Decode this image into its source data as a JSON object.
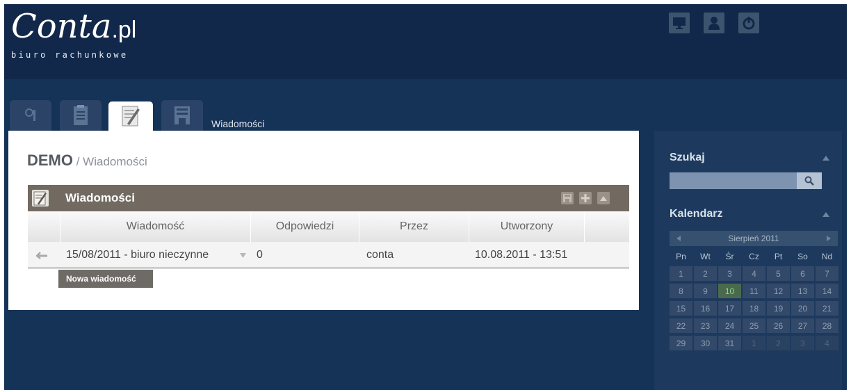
{
  "header": {
    "logo_main": "Conta",
    "logo_suffix": ".pl",
    "logo_sub": "biuro rachunkowe",
    "buttons": [
      "monitor-icon",
      "user-icon",
      "power-icon"
    ]
  },
  "tabs": {
    "items": [
      "tab-1",
      "tab-2",
      "tab-messages",
      "tab-4"
    ],
    "active_index": 2,
    "active_label": "Wiadomości"
  },
  "breadcrumb": {
    "company": "DEMO",
    "separator_page": " / Wiadomości"
  },
  "messages_box": {
    "title": "Wiadomości",
    "columns": [
      "Wiadomość",
      "Odpowiedzi",
      "Przez",
      "Utworzony"
    ],
    "rows": [
      {
        "message": "15/08/2011 - biuro nieczynne",
        "replies": "0",
        "by": "conta",
        "created": "10.08.2011 - 13:51"
      }
    ],
    "new_button": "Nowa wiadomość"
  },
  "sidebar": {
    "search_title": "Szukaj",
    "search_value": "",
    "calendar_title": "Kalendarz",
    "calendar": {
      "month": "Sierpień 2011",
      "weekdays": [
        "Pn",
        "Wt",
        "Śr",
        "Cz",
        "Pt",
        "So",
        "Nd"
      ],
      "weeks": [
        [
          "1",
          "2",
          "3",
          "4",
          "5",
          "6",
          "7"
        ],
        [
          "8",
          "9",
          "10",
          "11",
          "12",
          "13",
          "14"
        ],
        [
          "15",
          "16",
          "17",
          "18",
          "19",
          "20",
          "21"
        ],
        [
          "22",
          "23",
          "24",
          "25",
          "26",
          "27",
          "28"
        ],
        [
          "29",
          "30",
          "31",
          "1",
          "2",
          "3",
          "4"
        ]
      ],
      "today": "10"
    }
  },
  "colors": {
    "header_bg": "#12284a",
    "page_bg": "#153257",
    "box_header": "#726a61",
    "today_highlight": "#7fe07f"
  }
}
